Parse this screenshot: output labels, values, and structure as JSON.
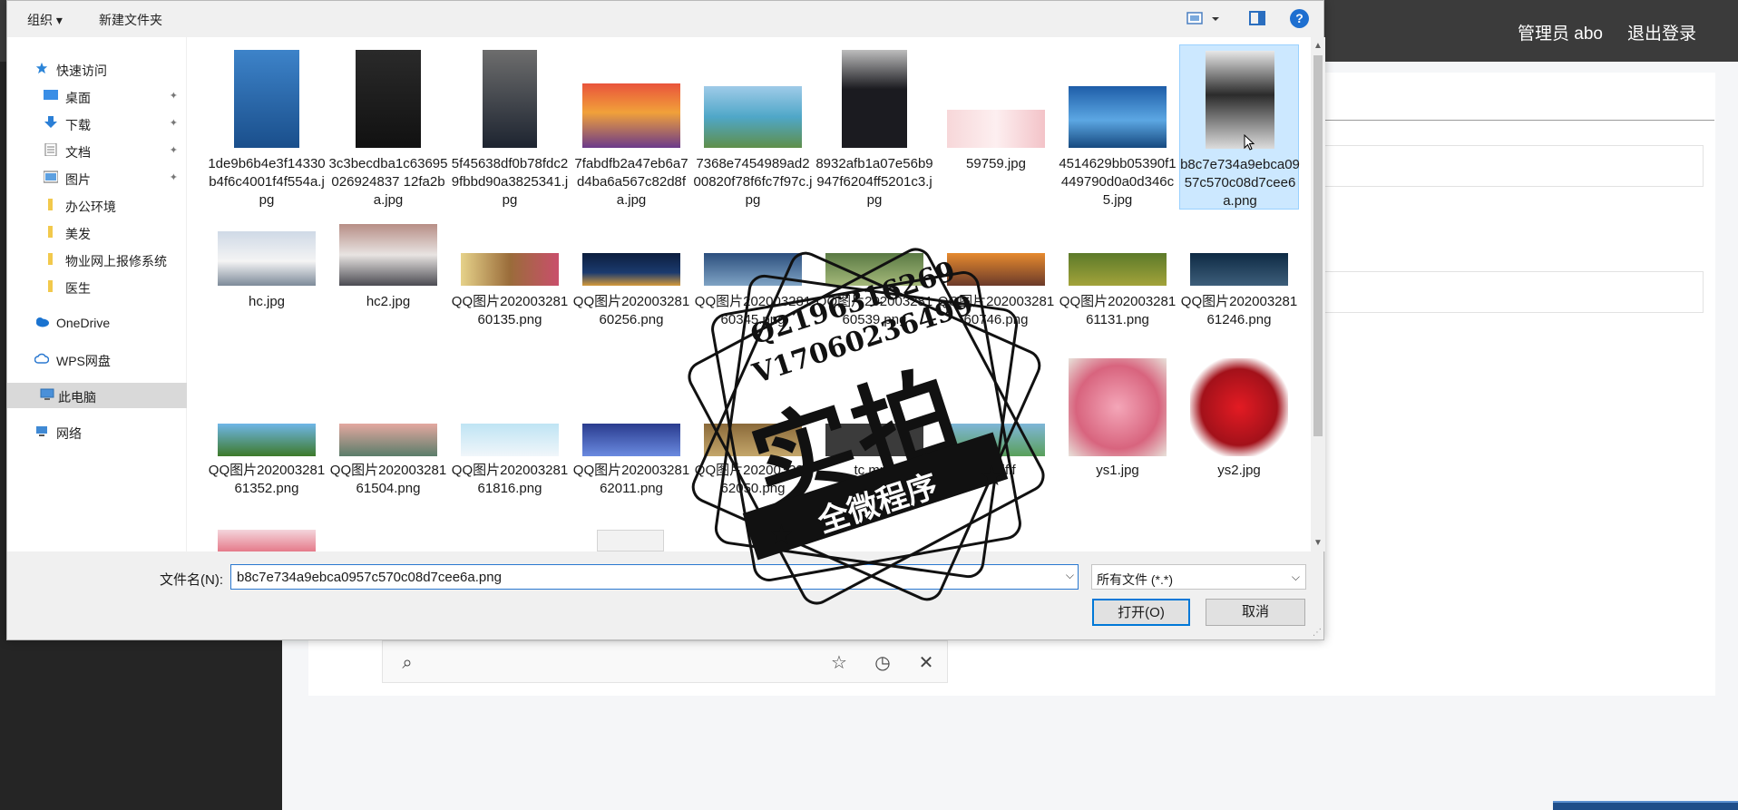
{
  "header": {
    "admin_label": "管理员 abo",
    "logout_label": "退出登录"
  },
  "dialog": {
    "toolbar": {
      "organize_label": "组织 ▾",
      "new_folder_label": "新建文件夹",
      "help_label": "?"
    },
    "nav": {
      "items": [
        {
          "label": "快速访问",
          "icon": "star-icon"
        },
        {
          "label": "桌面",
          "icon": "desktop-icon",
          "pinned": true
        },
        {
          "label": "下载",
          "icon": "download-icon",
          "pinned": true
        },
        {
          "label": "文档",
          "icon": "document-icon",
          "pinned": true
        },
        {
          "label": "图片",
          "icon": "pictures-icon",
          "pinned": true
        },
        {
          "label": "办公环境",
          "icon": "folder-icon"
        },
        {
          "label": "美发",
          "icon": "folder-icon"
        },
        {
          "label": "物业网上报修系统",
          "icon": "folder-icon"
        },
        {
          "label": "医生",
          "icon": "folder-icon"
        },
        {
          "label": "OneDrive",
          "icon": "cloud-icon"
        },
        {
          "label": "WPS网盘",
          "icon": "cloud-outline-icon"
        },
        {
          "label": "此电脑",
          "icon": "computer-icon",
          "selected": true
        },
        {
          "label": "网络",
          "icon": "network-icon"
        }
      ]
    },
    "files": [
      {
        "name": "1de9b6b4e3f14330b4f6c4001f4f554a.jpg"
      },
      {
        "name": "3c3becdba1c63695026924837 12fa2ba.jpg"
      },
      {
        "name": "5f45638df0b78fdc29fbbd90a3825341.jpg"
      },
      {
        "name": "7fabdfb2a47eb6a7d4ba6a567c82d8fa.jpg"
      },
      {
        "name": "7368e7454989ad200820f78f6fc7f97c.jpg"
      },
      {
        "name": "8932afb1a07e56b9947f6204ff5201c3.jpg"
      },
      {
        "name": "59759.jpg"
      },
      {
        "name": "4514629bb05390f1449790d0a0d346c5.jpg"
      },
      {
        "name": "b8c7e734a9ebca0957c570c08d7cee6a.png",
        "selected": true
      },
      {
        "name": "hc.jpg"
      },
      {
        "name": "hc2.jpg"
      },
      {
        "name": "QQ图片20200328160135.png"
      },
      {
        "name": "QQ图片20200328160256.png"
      },
      {
        "name": "QQ图片20200328160345.png"
      },
      {
        "name": "QQ图片20200328160539.png"
      },
      {
        "name": "QQ图片20200328160746.png"
      },
      {
        "name": "QQ图片20200328161131.png"
      },
      {
        "name": "QQ图片20200328161246.png"
      },
      {
        "name": "QQ图片20200328161352.png"
      },
      {
        "name": "QQ图片20200328161504.png"
      },
      {
        "name": "QQ图片20200328161816.png"
      },
      {
        "name": "QQ图片20200328162011.png"
      },
      {
        "name": "QQ图片20200328162050.png"
      },
      {
        "name": "tc.mp4"
      },
      {
        "name": "ting.ifif"
      },
      {
        "name": "ys1.jpg"
      },
      {
        "name": "ys2.jpg"
      }
    ],
    "filename_label": "文件名(N):",
    "filename_value": "b8c7e734a9ebca0957c570c08d7cee6a.png",
    "filetype_value": "所有文件 (*.*)",
    "open_label": "打开(O)",
    "cancel_label": "取消"
  },
  "watermark": {
    "line1": "Q2196316269",
    "line2": "V17060236499",
    "big_text": "实拍",
    "band_text": "全微程序"
  },
  "colors": {
    "accent": "#0078d7",
    "selection_bg": "#cce8ff",
    "topbar": "#3b3b3b",
    "sidebar": "#252525"
  }
}
